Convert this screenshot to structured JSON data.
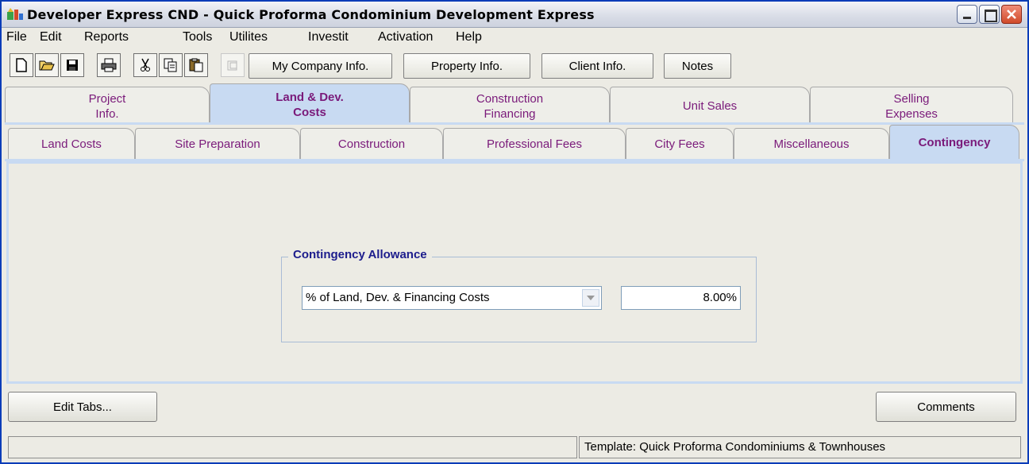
{
  "window": {
    "title": "Developer Express  CND - Quick Proforma Condominium Development  Express"
  },
  "menu": [
    "File",
    "Edit",
    "Reports",
    "Tools",
    "Utilites",
    "Investit",
    "Activation",
    "Help"
  ],
  "toolbar": {
    "icons": [
      "new-document-icon",
      "open-folder-icon",
      "save-disk-icon",
      "print-icon",
      "cut-scissors-icon",
      "copy-icon",
      "paste-icon",
      "disabled-tool-icon"
    ],
    "buttons": {
      "company": "My Company Info.",
      "property": "Property Info.",
      "client": "Client Info.",
      "notes": "Notes"
    }
  },
  "main_tabs": [
    {
      "line1": "Project",
      "line2": "Info."
    },
    {
      "line1": "Land & Dev.",
      "line2": "Costs"
    },
    {
      "line1": "Construction",
      "line2": "Financing"
    },
    {
      "line1": "Unit Sales",
      "line2": ""
    },
    {
      "line1": "Selling",
      "line2": "Expenses"
    }
  ],
  "sub_tabs": [
    "Land Costs",
    "Site Preparation",
    "Construction",
    "Professional Fees",
    "City Fees",
    "Miscellaneous",
    "Contingency"
  ],
  "contingency": {
    "group_title": "Contingency Allowance",
    "basis_selected": "% of Land, Dev. & Financing Costs",
    "percent_value": "8.00%"
  },
  "bottom": {
    "edit_tabs": "Edit Tabs...",
    "comments": "Comments"
  },
  "status": {
    "left": "",
    "template": "Template: Quick Proforma Condominiums & Townhouses"
  },
  "colors": {
    "tab_active": "#c8daf2",
    "tab_text": "#7a1a7a",
    "group_title": "#1c1c8c",
    "title_bar_border": "#0a3cb8"
  }
}
